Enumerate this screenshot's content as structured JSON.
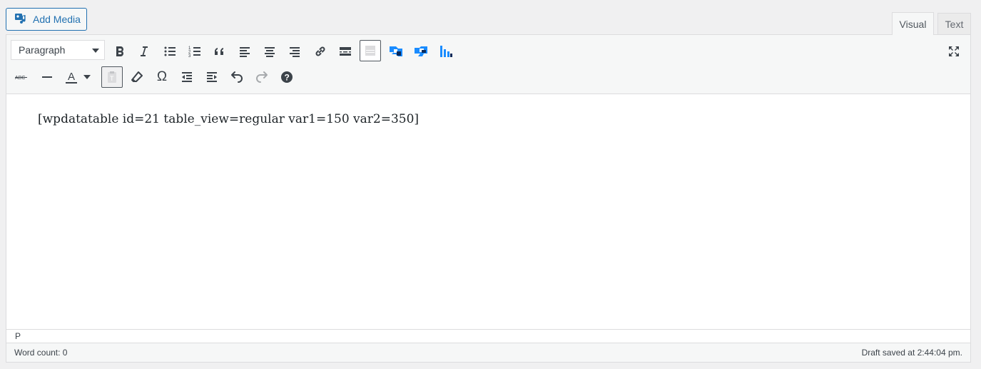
{
  "add_media": {
    "label": "Add Media",
    "icon": "add-media-icon"
  },
  "tabs": [
    {
      "label": "Visual",
      "active": true
    },
    {
      "label": "Text",
      "active": false
    }
  ],
  "toolbar": {
    "format_select": {
      "value": "Paragraph"
    },
    "row1": [
      "bold",
      "italic",
      "bulleted-list",
      "numbered-list",
      "blockquote",
      "align-left",
      "align-center",
      "align-right",
      "insert-link",
      "read-more",
      "toolbar-toggle",
      "wpdatatable",
      "wpdatatable-constructor",
      "wpdatachart",
      "fullscreen"
    ],
    "row2": [
      "strikethrough",
      "horizontal-line",
      "text-color",
      "text-color-dropdown",
      "paste-as-text",
      "clear-formatting",
      "special-character",
      "outdent",
      "indent",
      "undo",
      "redo",
      "keyboard-shortcuts"
    ],
    "text_color_letter": "A",
    "strike_letters": "ABC",
    "omega": "Ω"
  },
  "content": {
    "text": "[wpdatatable id=21 table_view=regular var1=150 var2=350]"
  },
  "path": {
    "text": "P"
  },
  "status": {
    "word_count": "Word count: 0",
    "draft_saved": "Draft saved at 2:44:04 pm."
  },
  "colors": {
    "accent": "#2271b1",
    "wpdt_blue": "#1a8cff",
    "wpdt_dark": "#0b2a5b"
  }
}
